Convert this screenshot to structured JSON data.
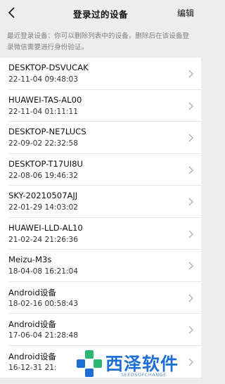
{
  "header": {
    "title": "登录过的设备",
    "edit_label": "编辑"
  },
  "notice": "最近登录设备：你可以删除列表中的设备，删除后在该设备登录微信需要进行身份验证。",
  "devices": [
    {
      "name": "DESKTOP-DSVUCAK",
      "time": "22-11-04 09:48:03"
    },
    {
      "name": "HUAWEI-TAS-AL00",
      "time": "22-11-04 01:11:11"
    },
    {
      "name": "DESKTOP-NE7LUCS",
      "time": "22-09-02 22:32:58"
    },
    {
      "name": "DESKTOP-T17UI8U",
      "time": "22-08-06 19:46:32"
    },
    {
      "name": "SKY-20210507AJJ",
      "time": "22-01-29 14:03:02"
    },
    {
      "name": "HUAWEI-LLD-AL10",
      "time": "21-02-24 21:26:36"
    },
    {
      "name": "Meizu-M3s",
      "time": "18-04-08 16:21:04"
    },
    {
      "name": "Android设备",
      "time": "18-02-16 00:58:43"
    },
    {
      "name": "Android设备",
      "time": "17-06-04 21:28:48"
    },
    {
      "name": "Android设备",
      "time": "16-12-31 21:"
    }
  ],
  "watermark": {
    "brand": "西泽软件",
    "tagline": "SEEDSOFCHANGE"
  },
  "colors": {
    "background": "#ededed",
    "list_background": "#ffffff",
    "watermark_blue": "#1d6fd6",
    "watermark_green": "#2bb673"
  },
  "icons": {
    "back": "chevron-left-icon",
    "row": "chevron-right-icon"
  }
}
